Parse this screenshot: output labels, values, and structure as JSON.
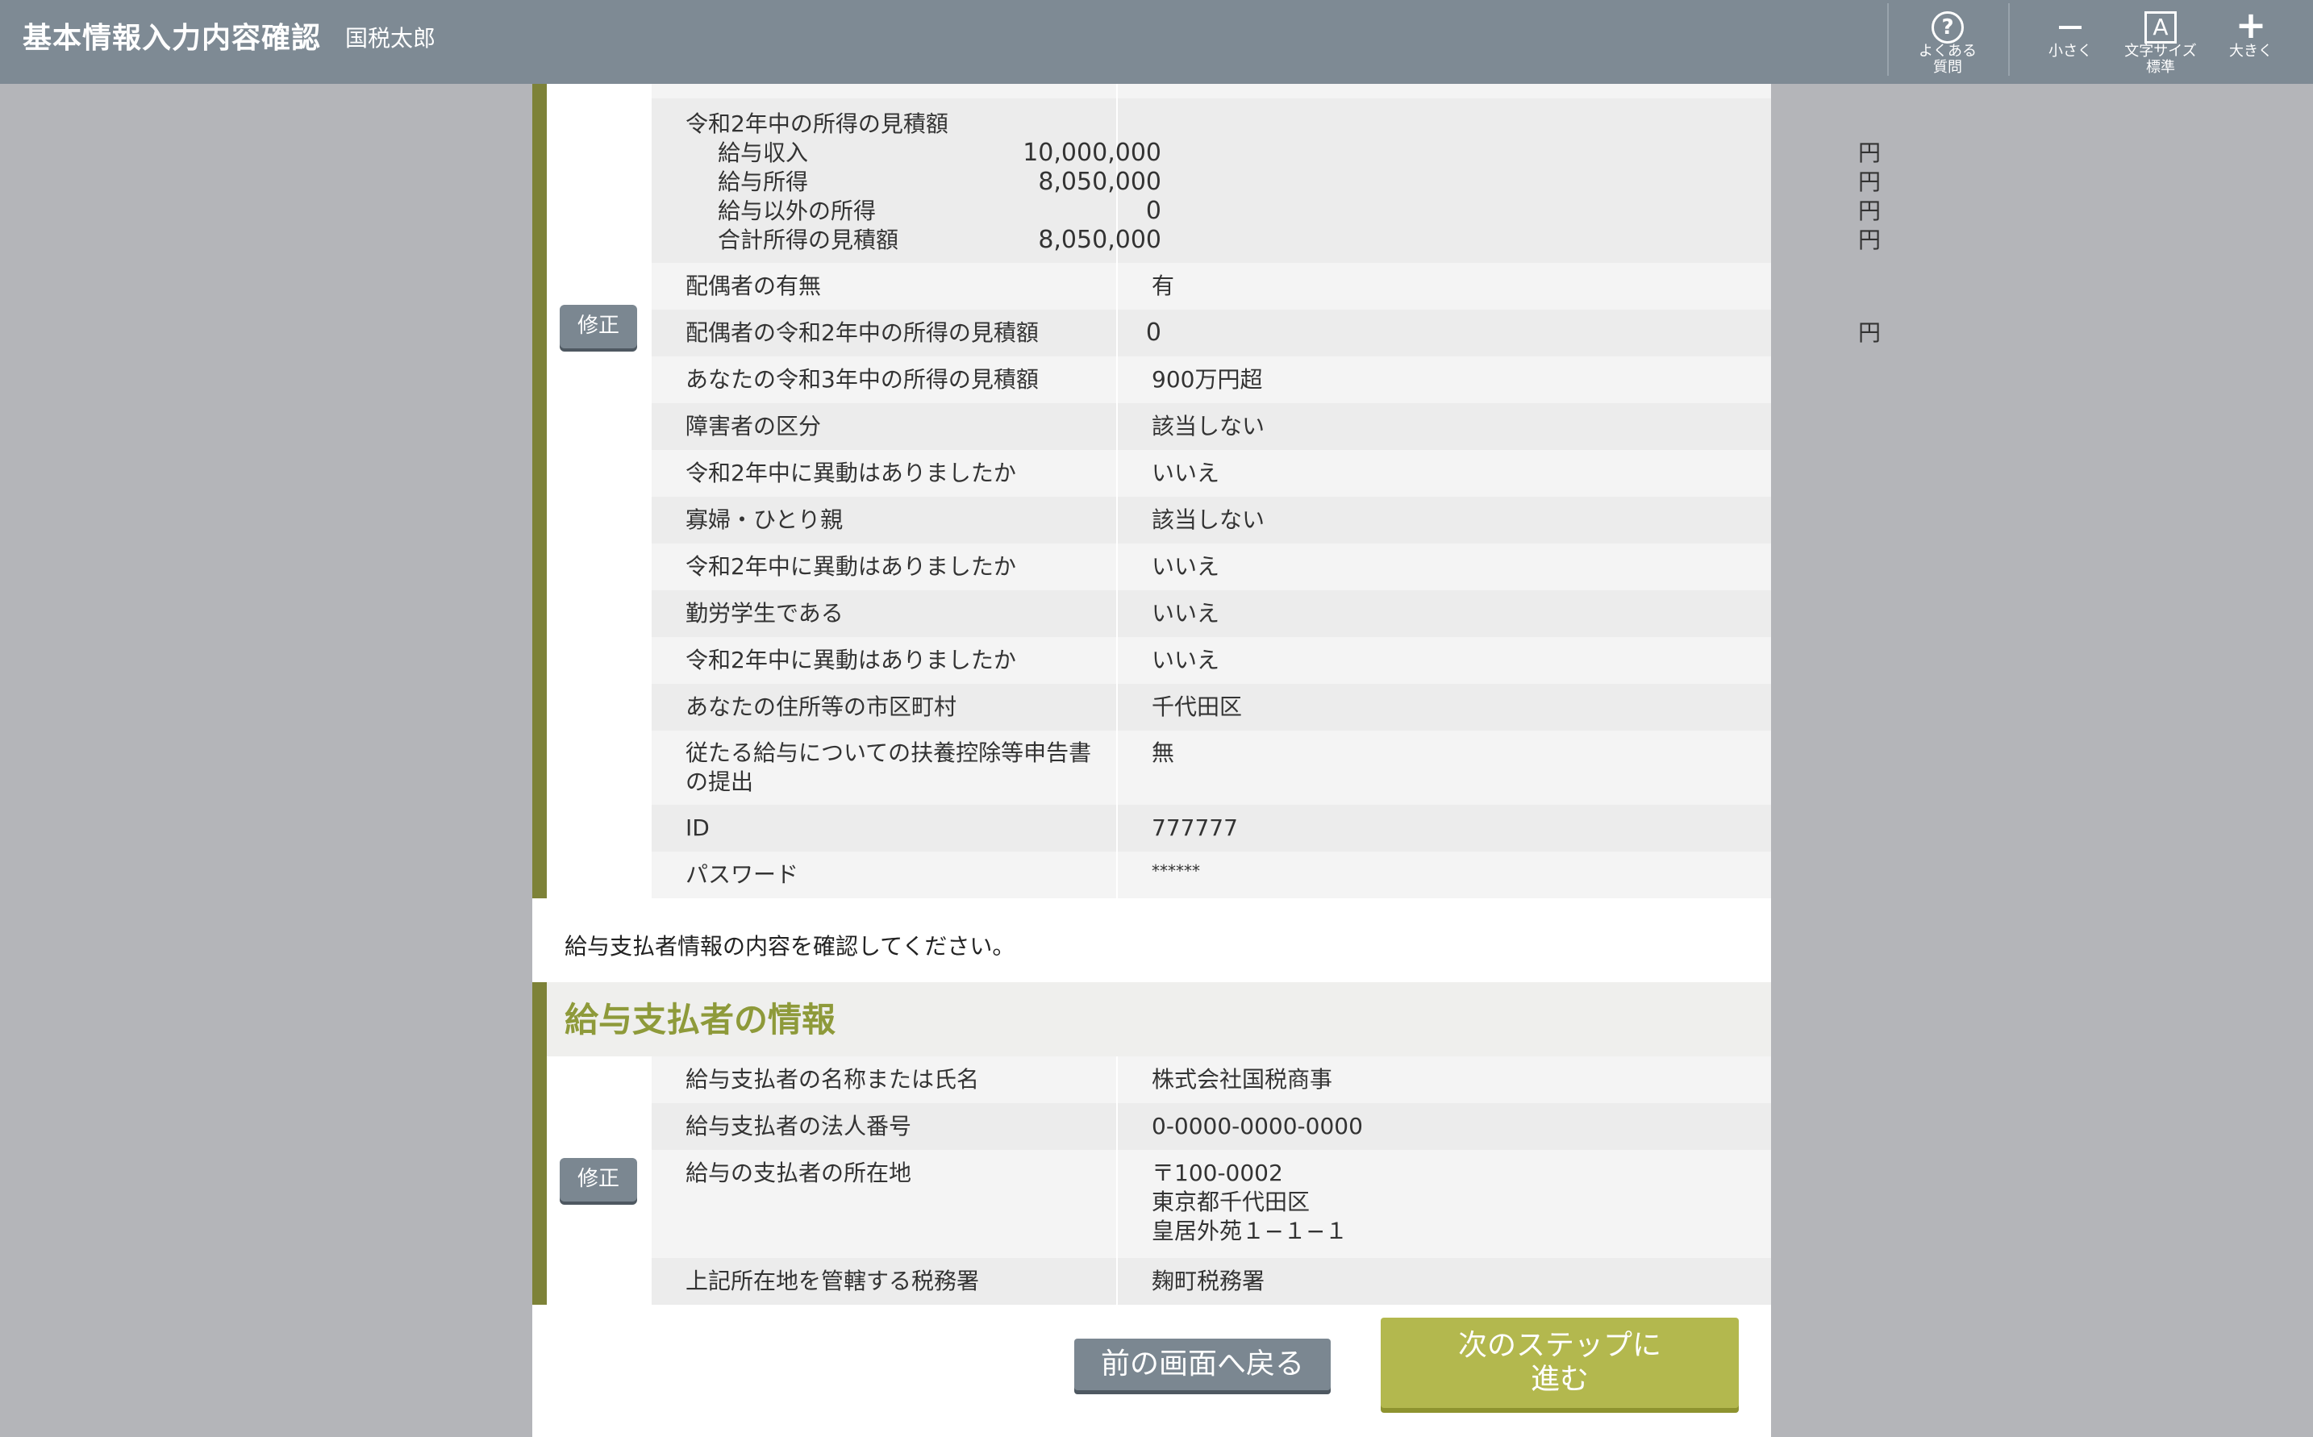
{
  "header": {
    "title": "基本情報入力内容確認",
    "user": "国税太郎",
    "faq_label": [
      "よくある",
      "質問"
    ],
    "smaller_label": "小さく",
    "fontsize_label": [
      "文字サイズ",
      "標準"
    ],
    "larger_label": "大きく",
    "fontsize_icon_letter": "A"
  },
  "section1": {
    "fix_label": "修正",
    "income": {
      "label": "令和2年中の所得の見積額",
      "items": [
        {
          "label": "給与収入",
          "amount": "10,000,000",
          "unit": "円"
        },
        {
          "label": "給与所得",
          "amount": "8,050,000",
          "unit": "円"
        },
        {
          "label": "給与以外の所得",
          "amount": "0",
          "unit": "円"
        },
        {
          "label": "合計所得の見積額",
          "amount": "8,050,000",
          "unit": "円"
        }
      ]
    },
    "rows": [
      {
        "label": "配偶者の有無",
        "value": "有"
      },
      {
        "label": "配偶者の令和2年中の所得の見積額",
        "amount": "0",
        "unit": "円"
      },
      {
        "label": "あなたの令和3年中の所得の見積額",
        "value": "900万円超"
      },
      {
        "label": "障害者の区分",
        "value": "該当しない"
      },
      {
        "label": "令和2年中に異動はありましたか",
        "value": "いいえ"
      },
      {
        "label": "寡婦・ひとり親",
        "value": "該当しない"
      },
      {
        "label": "令和2年中に異動はありましたか",
        "value": "いいえ"
      },
      {
        "label": "勤労学生である",
        "value": "いいえ"
      },
      {
        "label": "令和2年中に異動はありましたか",
        "value": "いいえ"
      },
      {
        "label": "あなたの住所等の市区町村",
        "value": "千代田区"
      },
      {
        "label": "従たる給与についての扶養控除等申告書の提出",
        "value": "無"
      },
      {
        "label": "ID",
        "value": "777777"
      },
      {
        "label": "パスワード",
        "value": "******"
      }
    ]
  },
  "note": "給与支払者情報の内容を確認してください。",
  "section2": {
    "title": "給与支払者の情報",
    "fix_label": "修正",
    "rows": [
      {
        "label": "給与支払者の名称または氏名",
        "value": "株式会社国税商事"
      },
      {
        "label": "給与支払者の法人番号",
        "value": "0-0000-0000-0000"
      },
      {
        "label": "給与の支払者の所在地",
        "lines": [
          "〒100-0002",
          "東京都千代田区",
          "皇居外苑１−１−１"
        ]
      },
      {
        "label": "上記所在地を管轄する税務署",
        "value": "麹町税務署"
      }
    ]
  },
  "buttons": {
    "back": "前の画面へ戻る",
    "next": "次のステップに進む"
  }
}
